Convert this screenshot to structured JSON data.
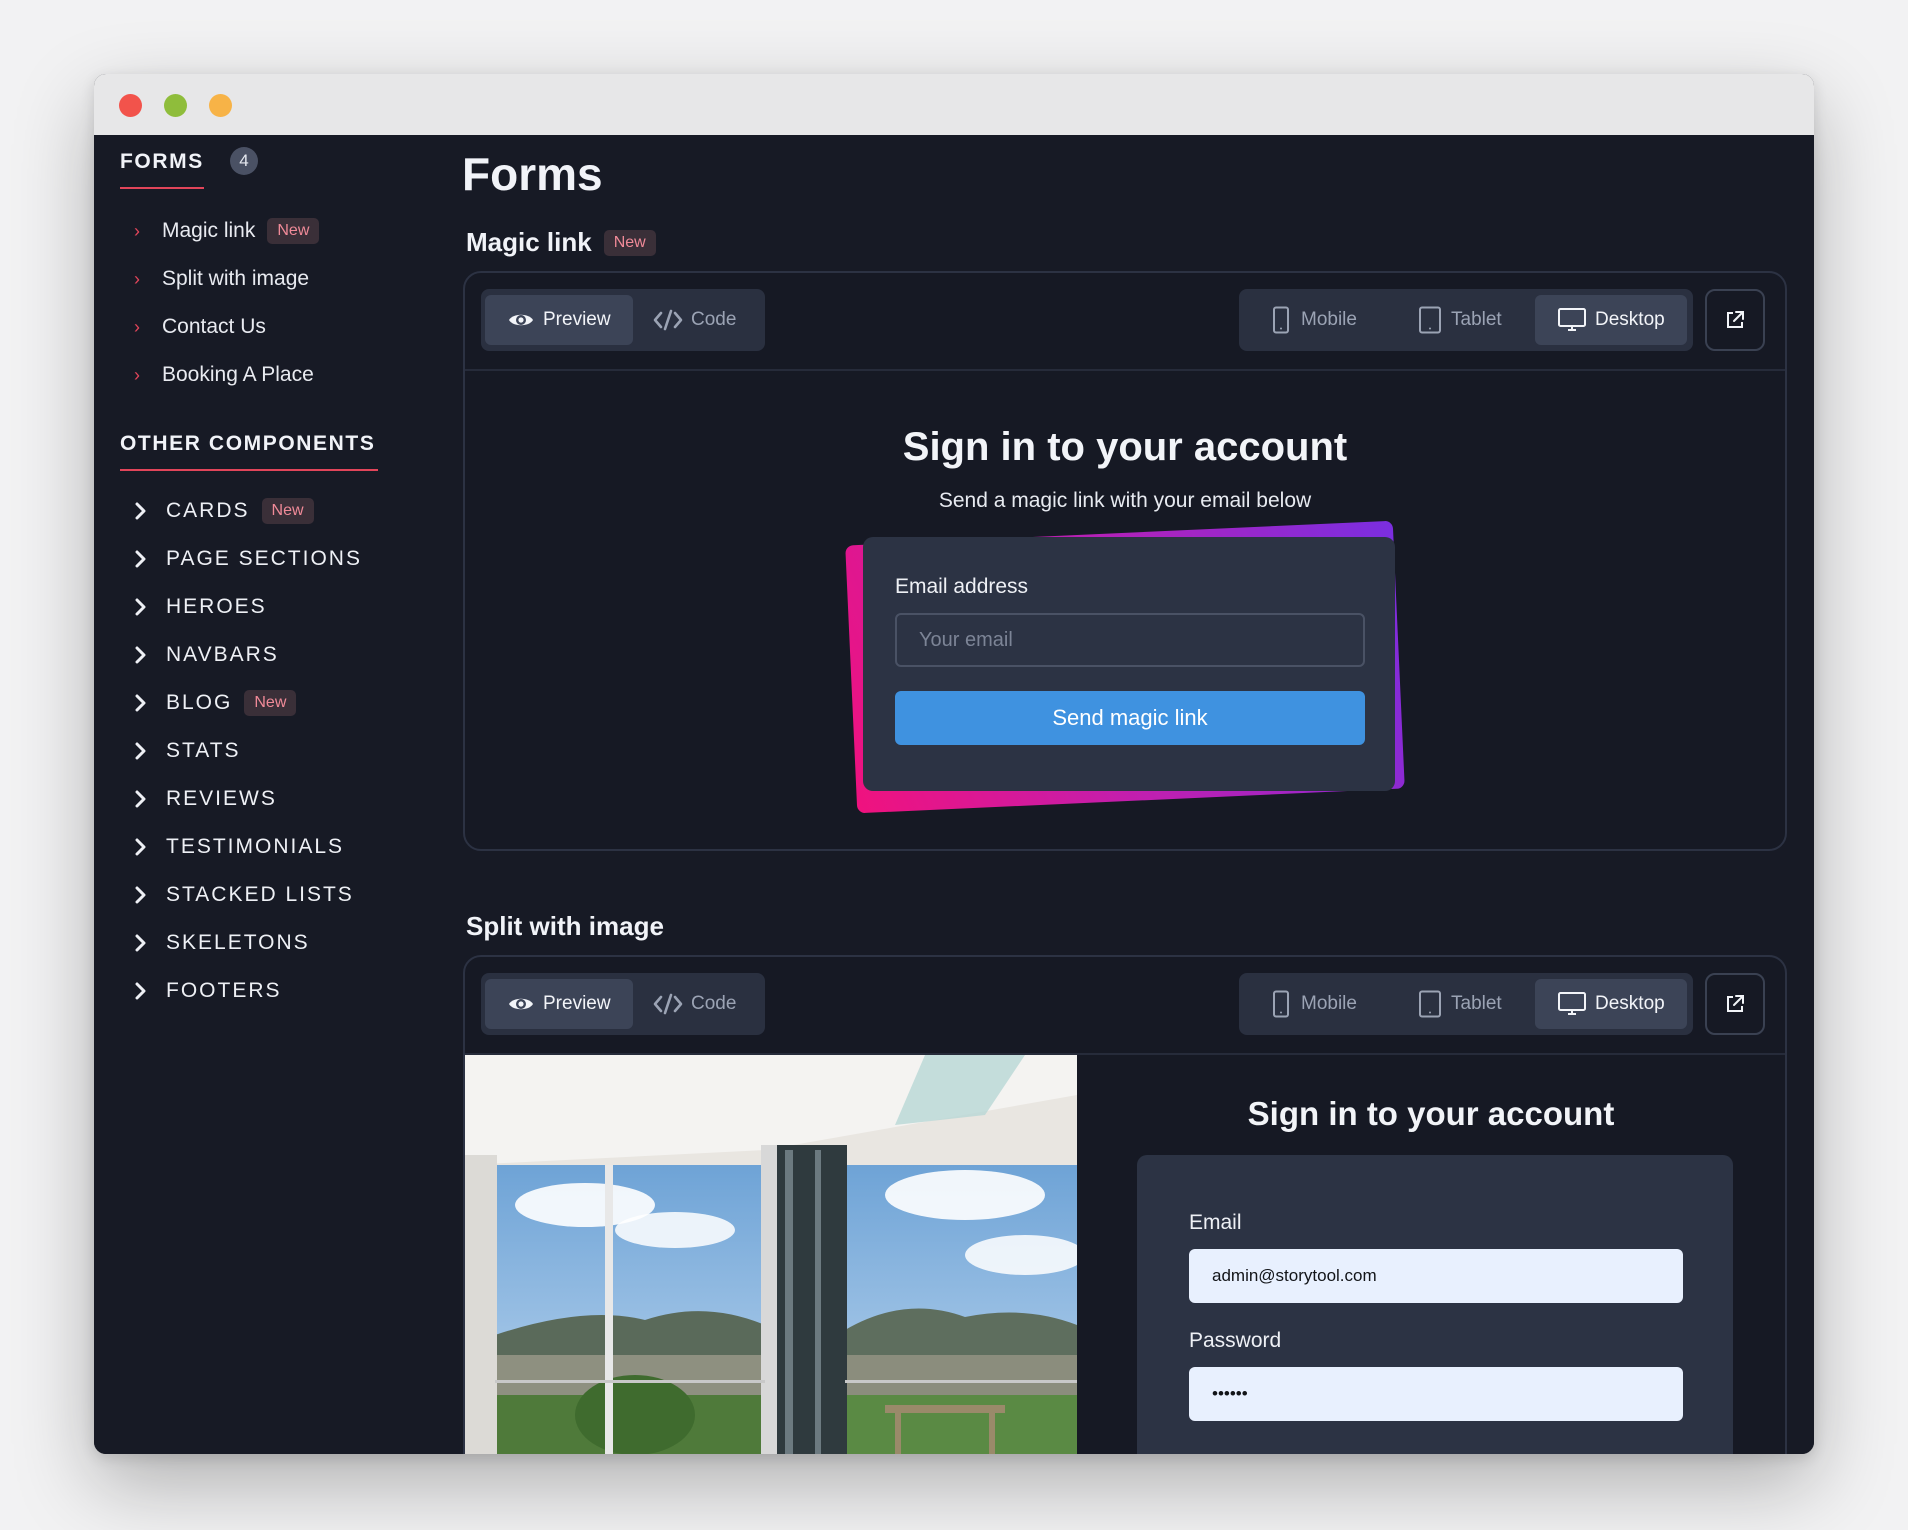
{
  "sidebar": {
    "forms_title": "FORMS",
    "forms_count": "4",
    "forms_items": [
      {
        "label": "Magic link",
        "badge": "New"
      },
      {
        "label": "Split with image"
      },
      {
        "label": "Contact Us"
      },
      {
        "label": "Booking A Place"
      }
    ],
    "other_title": "OTHER COMPONENTS",
    "other_items": [
      {
        "label": "CARDS",
        "badge": "New"
      },
      {
        "label": "PAGE SECTIONS"
      },
      {
        "label": "HEROES"
      },
      {
        "label": "NAVBARS"
      },
      {
        "label": "BLOG",
        "badge": "New"
      },
      {
        "label": "STATS"
      },
      {
        "label": "REVIEWS"
      },
      {
        "label": "TESTIMONIALS"
      },
      {
        "label": "STACKED LISTS"
      },
      {
        "label": "SKELETONS"
      },
      {
        "label": "FOOTERS"
      }
    ]
  },
  "main": {
    "page_title": "Forms",
    "toolbar": {
      "preview": "Preview",
      "code": "Code",
      "mobile": "Mobile",
      "tablet": "Tablet",
      "desktop": "Desktop"
    },
    "sections": [
      {
        "title": "Magic link",
        "badge": "New",
        "preview": {
          "title": "Sign in to your account",
          "subtitle": "Send a magic link with your email below",
          "email_label": "Email address",
          "email_placeholder": "Your email",
          "button": "Send magic link"
        }
      },
      {
        "title": "Split with image",
        "preview": {
          "title": "Sign in to your account",
          "email_label": "Email",
          "email_value": "admin@storytool.com",
          "password_label": "Password",
          "password_value": "••••••"
        }
      }
    ]
  },
  "colors": {
    "background": "#171a25",
    "accent": "#e2455a",
    "primary_button": "#3f92e0"
  },
  "icons": [
    "eye-icon",
    "code-icon",
    "mobile-icon",
    "tablet-icon",
    "desktop-icon",
    "external-link-icon",
    "chevron-right-icon"
  ]
}
